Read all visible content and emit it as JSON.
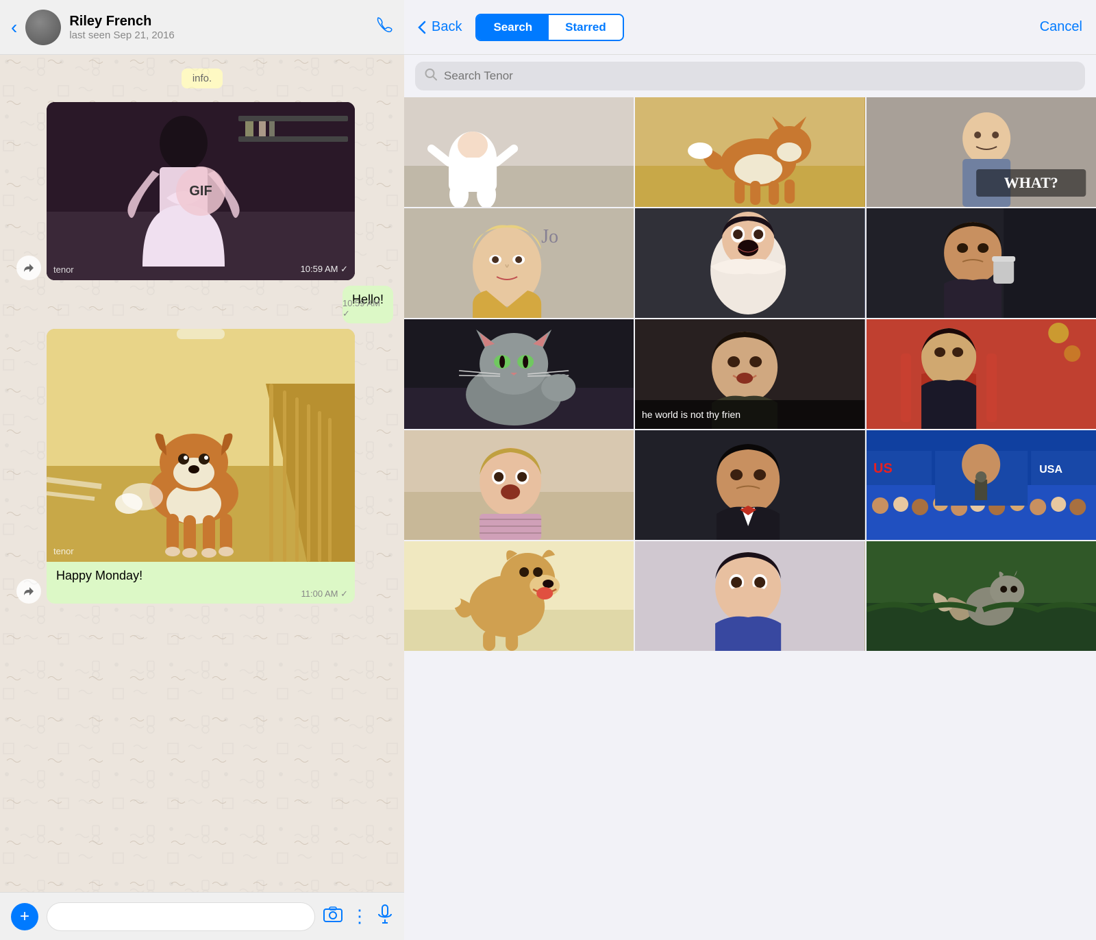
{
  "chat": {
    "contact_name": "Riley French",
    "contact_status": "last seen Sep 21, 2016",
    "info_label": "info.",
    "gif_label": "GIF",
    "tenor_label": "tenor",
    "gif_time": "10:59 AM ✓",
    "hello_text": "Hello!",
    "hello_time": "10:59 AM ✓",
    "caption_text": "Happy Monday!",
    "caption_time": "11:00 AM ✓",
    "input_placeholder": "",
    "back_label": "‹",
    "phone_label": "📞"
  },
  "gif_picker": {
    "back_label": "Back",
    "search_tab": "Search",
    "starred_tab": "Starred",
    "cancel_label": "Cancel",
    "search_placeholder": "Search Tenor",
    "gifs": [
      {
        "id": 1,
        "color": "c1",
        "row": 1,
        "col": 1
      },
      {
        "id": 2,
        "color": "c2",
        "row": 1,
        "col": 2
      },
      {
        "id": 3,
        "color": "c3",
        "row": 1,
        "col": 3
      },
      {
        "id": 4,
        "color": "c4",
        "row": 2,
        "col": 1
      },
      {
        "id": 5,
        "color": "c5",
        "row": 2,
        "col": 2
      },
      {
        "id": 6,
        "color": "c6",
        "row": 2,
        "col": 3
      },
      {
        "id": 7,
        "color": "c7",
        "row": 3,
        "col": 1
      },
      {
        "id": 8,
        "color": "c8",
        "row": 3,
        "col": 2
      },
      {
        "id": 9,
        "color": "c9",
        "row": 3,
        "col": 3
      },
      {
        "id": 10,
        "color": "c10",
        "row": 4,
        "col": 1
      },
      {
        "id": 11,
        "color": "c11",
        "row": 4,
        "col": 2
      },
      {
        "id": 12,
        "color": "c12",
        "row": 4,
        "col": 3
      },
      {
        "id": 13,
        "color": "c13",
        "row": 5,
        "col": 1
      },
      {
        "id": 14,
        "color": "c14",
        "row": 5,
        "col": 2
      },
      {
        "id": 15,
        "color": "c15",
        "row": 5,
        "col": 3
      }
    ],
    "gif_text_overlay": {
      "r1c3": "WHAT?",
      "r3c2": "he world is not thy frien"
    }
  },
  "toolbar": {
    "plus_label": "+",
    "camera_label": "📷",
    "dots_label": "⋮",
    "mic_label": "🎤"
  }
}
